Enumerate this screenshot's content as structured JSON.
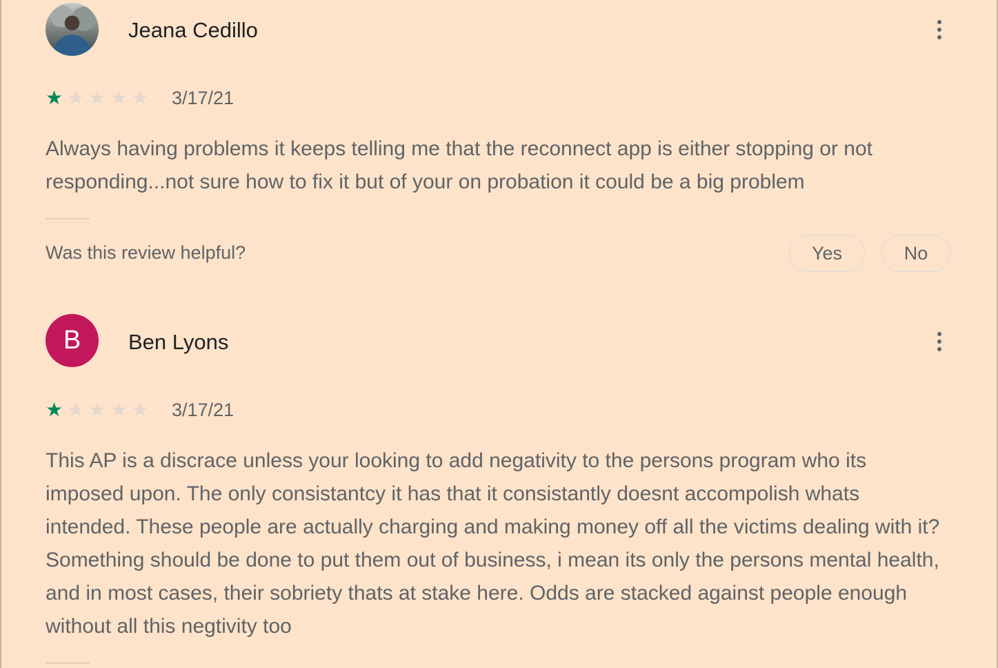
{
  "reviews": [
    {
      "reviewer": "Jeana Cedillo",
      "avatar": "photo",
      "rating": 1,
      "max_rating": 5,
      "date": "3/17/21",
      "text": "Always having problems it keeps telling me that the reconnect app is either stopping or not responding...not sure how to fix it but of your on probation it could be a big problem",
      "helpful_prompt": "Was this review helpful?",
      "yes_label": "Yes",
      "no_label": "No",
      "menu_icon": "more-vert-icon"
    },
    {
      "reviewer": "Ben Lyons",
      "avatar_letter": "B",
      "avatar_color": "#c2185b",
      "rating": 1,
      "max_rating": 5,
      "date": "3/17/21",
      "text": "This AP is a discrace unless your looking to add negativity to the persons program who its imposed upon. The only consistantcy it has that it consistantly doesnt accompolish whats intended. These people are actually charging and making money off all the victims dealing with it? Something should be done to put them out of business, i mean its only the persons mental health, and in most cases, their sobriety thats at stake here. Odds are stacked against people enough without all this negtivity too",
      "menu_icon": "more-vert-icon"
    }
  ],
  "colors": {
    "background": "#fde3c9",
    "star_filled": "#01875f",
    "star_empty": "#e4d8cc",
    "secondary_text": "#5f6368"
  }
}
